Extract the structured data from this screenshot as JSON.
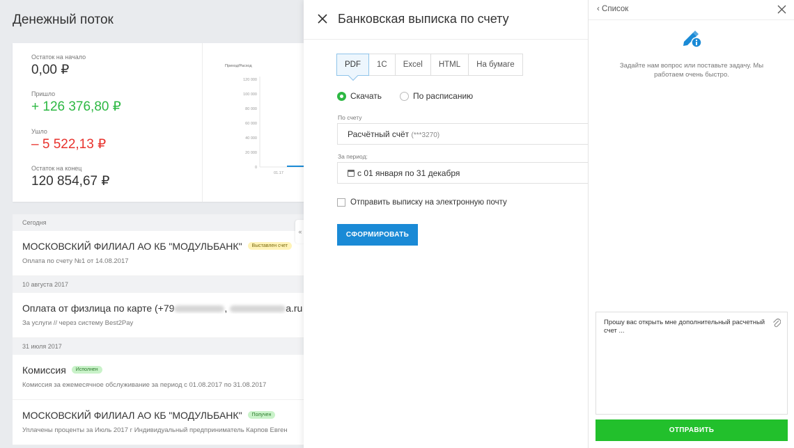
{
  "page": {
    "title": "Денежный поток"
  },
  "summary": {
    "start_label": "Остаток на начало",
    "start_value": "0,00 ₽",
    "in_label": "Пришло",
    "in_value": "+ 126 376,80 ₽",
    "out_label": "Ушло",
    "out_value": "– 5 522,13 ₽",
    "end_label": "Остаток на конец",
    "end_value": "120 854,67 ₽"
  },
  "chart_data": {
    "type": "bar",
    "title": "Приход/Расход",
    "categories": [
      "01.17"
    ],
    "y_ticks": [
      "120 000",
      "100 000",
      "80 000",
      "60 000",
      "40 000",
      "20 000",
      "0"
    ],
    "ylim": [
      0,
      120000
    ],
    "colors": {
      "bar": "#1a8ad6"
    }
  },
  "feed": {
    "groups": [
      {
        "date": "Сегодня",
        "items": [
          {
            "title": "МОСКОВСКИЙ ФИЛИАЛ АО КБ \"МОДУЛЬБАНК\"",
            "badge": "Выставлен счет",
            "sub": "Оплата по счету №1 от 14.08.2017"
          }
        ]
      },
      {
        "date": "10 августа 2017",
        "items": [
          {
            "title_pre": "Оплата от физлица по карте (+79",
            "title_sep": ", ",
            "title_post": "a.ru)",
            "sub": "За услуги // через систему Best2Pay"
          }
        ]
      },
      {
        "date": "31 июля 2017",
        "items": [
          {
            "title": "Комиссия",
            "badge": "Исполнен",
            "sub": "Комиссия за ежемесячное обслуживание за период с 01.08.2017 по 31.08.2017"
          },
          {
            "title": "МОСКОВСКИЙ ФИЛИАЛ АО КБ \"МОДУЛЬБАНК\"",
            "badge": "Получен",
            "sub": "Уплачены проценты за Июль 2017 г Индивидуальный предприниматель Карпов Евген"
          }
        ]
      }
    ],
    "collapse_glyph": "«"
  },
  "modal": {
    "title": "Банковская выписка по счету",
    "formats": [
      "PDF",
      "1С",
      "Excel",
      "HTML",
      "На бумаге"
    ],
    "active_format": "PDF",
    "radio_download": "Скачать",
    "radio_schedule": "По расписанию",
    "account_label": "По счету",
    "account_value": "Расчётный счёт",
    "account_suffix": "(***3270)",
    "period_label": "За период:",
    "period_value": "с 01 января по 31 декабря",
    "email_checkbox": "Отправить выписку на электронную почту",
    "submit": "СФОРМИРОВАТЬ"
  },
  "chat": {
    "back_label": "Список",
    "intro": "Задайте нам вопрос или поставьте задачу. Мы работаем очень быстро.",
    "message": "Прошу вас открыть мне дополнительный расчетный счет ...",
    "send": "ОТПРАВИТЬ",
    "colors": {
      "send": "#22c02c",
      "icon": "#1a8ad6"
    }
  }
}
